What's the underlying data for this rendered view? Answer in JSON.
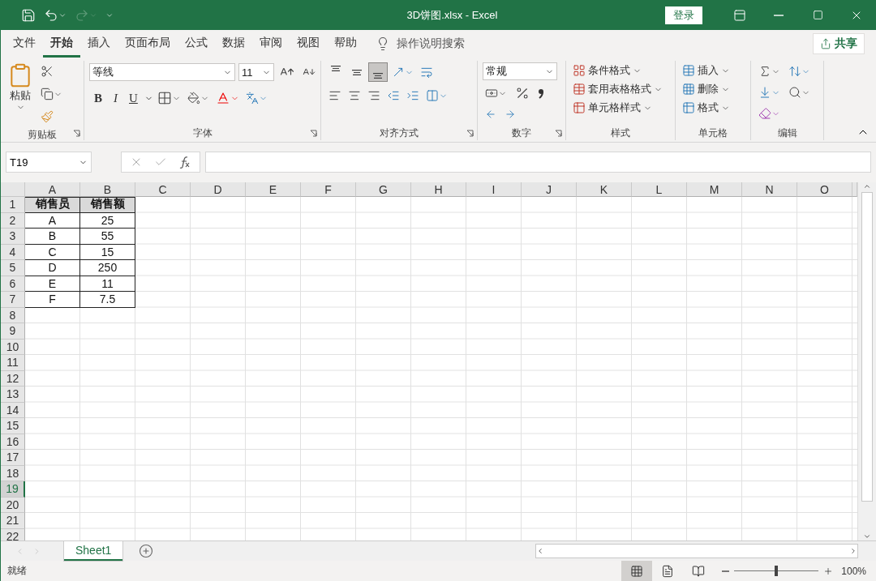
{
  "window": {
    "title": "3D饼图.xlsx  -  Excel",
    "sign_in": "登录"
  },
  "tabs": [
    {
      "label": "文件",
      "selected": false
    },
    {
      "label": "开始",
      "selected": true
    },
    {
      "label": "插入",
      "selected": false
    },
    {
      "label": "页面布局",
      "selected": false
    },
    {
      "label": "公式",
      "selected": false
    },
    {
      "label": "数据",
      "selected": false
    },
    {
      "label": "审阅",
      "selected": false
    },
    {
      "label": "视图",
      "selected": false
    },
    {
      "label": "帮助",
      "selected": false
    }
  ],
  "tell_me": {
    "placeholder": "操作说明搜索"
  },
  "share": "共享",
  "ribbon": {
    "groups": [
      {
        "label": "剪贴板",
        "launcher": true
      },
      {
        "label": "字体",
        "launcher": true
      },
      {
        "label": "对齐方式",
        "launcher": true
      },
      {
        "label": "数字",
        "launcher": true
      },
      {
        "label": "样式",
        "launcher": false
      },
      {
        "label": "单元格",
        "launcher": false
      },
      {
        "label": "编辑",
        "launcher": false
      }
    ],
    "clipboard": {
      "paste": "粘贴"
    },
    "font": {
      "name": "等线",
      "size": "11",
      "bold": "B",
      "italic": "I",
      "underline": "U"
    },
    "alignment": {
      "vertical": [
        {
          "selected": false
        },
        {
          "selected": false
        },
        {
          "selected": true
        }
      ]
    },
    "number": {
      "format": "常规"
    },
    "styles": [
      "条件格式",
      "套用表格格式",
      "单元格样式"
    ],
    "cells": [
      "插入",
      "删除",
      "格式"
    ]
  },
  "formula_bar": {
    "name_box": "T19"
  },
  "grid": {
    "columns": [
      "A",
      "B",
      "C",
      "D",
      "E",
      "F",
      "G",
      "H",
      "I",
      "J",
      "K",
      "L",
      "M",
      "N",
      "O"
    ],
    "rows": [
      {
        "header": "1",
        "selected": false,
        "kind": "header",
        "cells": [
          "销售员",
          "销售额"
        ]
      },
      {
        "header": "2",
        "selected": false,
        "kind": "data",
        "cells": [
          "A",
          "25"
        ]
      },
      {
        "header": "3",
        "selected": false,
        "kind": "data",
        "cells": [
          "B",
          "55"
        ]
      },
      {
        "header": "4",
        "selected": false,
        "kind": "data",
        "cells": [
          "C",
          "15"
        ]
      },
      {
        "header": "5",
        "selected": false,
        "kind": "data",
        "cells": [
          "D",
          "250"
        ]
      },
      {
        "header": "6",
        "selected": false,
        "kind": "data",
        "cells": [
          "E",
          "11"
        ]
      },
      {
        "header": "7",
        "selected": false,
        "kind": "data",
        "cells": [
          "F",
          "7.5"
        ]
      },
      {
        "header": "8",
        "selected": false
      },
      {
        "header": "9",
        "selected": false
      },
      {
        "header": "10",
        "selected": false
      },
      {
        "header": "11",
        "selected": false
      },
      {
        "header": "12",
        "selected": false
      },
      {
        "header": "13",
        "selected": false
      },
      {
        "header": "14",
        "selected": false
      },
      {
        "header": "15",
        "selected": false
      },
      {
        "header": "16",
        "selected": false
      },
      {
        "header": "17",
        "selected": false
      },
      {
        "header": "18",
        "selected": false
      },
      {
        "header": "19",
        "selected": true
      },
      {
        "header": "20",
        "selected": false
      },
      {
        "header": "21",
        "selected": false
      },
      {
        "header": "22",
        "selected": false
      }
    ]
  },
  "sheets": [
    {
      "label": "Sheet1",
      "selected": true
    }
  ],
  "status_bar": {
    "status": "就绪",
    "views": [
      {
        "selected": true
      },
      {
        "selected": false
      },
      {
        "selected": false
      }
    ],
    "zoom": {
      "level": 0.5,
      "reading": "100%"
    }
  }
}
